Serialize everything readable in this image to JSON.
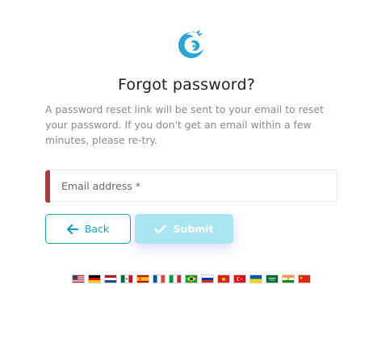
{
  "page": {
    "title": "Forgot password?",
    "description": "A password reset link will be sent to your email to reset your password. If you don't get an email within a few minutes, please re-try."
  },
  "form": {
    "email_placeholder": "Email address *",
    "email_value": ""
  },
  "buttons": {
    "back_label": "Back",
    "submit_label": "Submit"
  },
  "icons": {
    "logo": "dragon-logo-icon",
    "back": "arrow-left-icon",
    "submit": "check-icon"
  },
  "colors": {
    "accent": "#17a2b8",
    "submit_disabled": "#a8e6f2",
    "error_bar": "#a63d40"
  },
  "languages": [
    {
      "name": "flag-us-icon"
    },
    {
      "name": "flag-de-icon"
    },
    {
      "name": "flag-nl-icon"
    },
    {
      "name": "flag-mx-icon"
    },
    {
      "name": "flag-es-icon"
    },
    {
      "name": "flag-fr-icon"
    },
    {
      "name": "flag-it-icon"
    },
    {
      "name": "flag-br-icon"
    },
    {
      "name": "flag-ru-icon"
    },
    {
      "name": "flag-vn-icon"
    },
    {
      "name": "flag-tr-icon"
    },
    {
      "name": "flag-ua-icon"
    },
    {
      "name": "flag-sa-icon"
    },
    {
      "name": "flag-in-icon"
    },
    {
      "name": "flag-cn-icon"
    }
  ]
}
